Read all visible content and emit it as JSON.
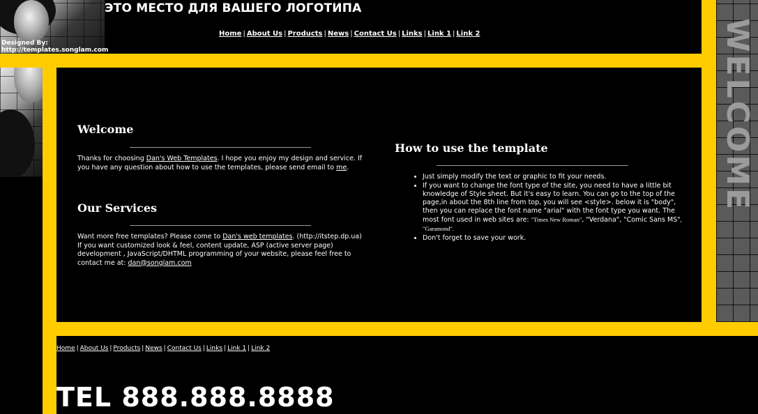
{
  "header": {
    "logo_text": "ЭТО МЕСТО ДЛЯ ВАШЕГО ЛОГОТИПА",
    "designed_by_label": "Designed By:",
    "designed_by_url": "http://templates.songlam.com",
    "nav": [
      "Home",
      "About Us",
      "Products",
      "News",
      "Contact Us",
      "Links",
      "Link 1",
      "Link 2"
    ]
  },
  "side_banner": {
    "text": "WELCOME"
  },
  "welcome": {
    "title": "Welcome",
    "text_before_link": "Thanks for choosing ",
    "link": "Dan's Web Templates",
    "text_after_link": ". I hope you enjoy my design and service. If you have any question about how to use the templates, please send email to ",
    "email_link": "me",
    "text_end": "."
  },
  "services": {
    "title": "Our Services",
    "text_before_link": "Want more free templates? Please come to ",
    "link": "Dan's web templates",
    "text_after_link": ". (http://itstep.dp.ua) If you want customized look & feel, content update, ASP (active server page) development , JavaScript/DHTML programming of your website, please feel free to contact me at: ",
    "email": "dan@songlam.com"
  },
  "howto": {
    "title": "How to use the template",
    "item1": "Just simply modify the text or graphic to fit your needs.",
    "item2_text": "If you want to change the font type of the site, you need to have a little bit knowledge of Style sheet. But it's easy to learn. You can go to the top of the page,in about the 8th line from top, you will see <style>. below it is \"body\", then you can replace the font name \"arial\" with the font type you want. The most font used in web sites are: ",
    "font1": "\"Times New Roman\"",
    "font2": ", \"Verdana\",",
    "font3": "\"Comic Sans MS\"",
    "font4": ", \"Garamond\".",
    "item3": "Don't forget to save your work."
  },
  "footer": {
    "nav": [
      "Home",
      "About Us",
      "Products",
      "News",
      "Contact Us",
      "Links",
      "Link 1",
      "Link 2"
    ],
    "tel": "TEL 888.888.8888"
  },
  "colors": {
    "accent": "#ffcc00",
    "background": "#000000"
  }
}
